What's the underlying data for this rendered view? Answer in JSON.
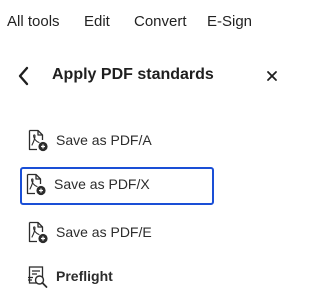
{
  "menubar": {
    "items": [
      {
        "label": "All tools"
      },
      {
        "label": "Edit"
      },
      {
        "label": "Convert"
      },
      {
        "label": "E-Sign"
      }
    ]
  },
  "panel": {
    "title": "Apply PDF standards",
    "back_icon": "chevron-left-icon",
    "close_icon": "close-icon"
  },
  "tools": [
    {
      "label": "Save as PDF/A",
      "icon": "pdf-standard-icon",
      "selected": false
    },
    {
      "label": "Save as PDF/X",
      "icon": "pdf-standard-icon",
      "selected": true
    },
    {
      "label": "Save as PDF/E",
      "icon": "pdf-standard-icon",
      "selected": false
    },
    {
      "label": "Preflight",
      "icon": "preflight-icon",
      "selected": false
    }
  ],
  "colors": {
    "selection_border": "#1a4fd6",
    "text": "#2c2c2c"
  }
}
